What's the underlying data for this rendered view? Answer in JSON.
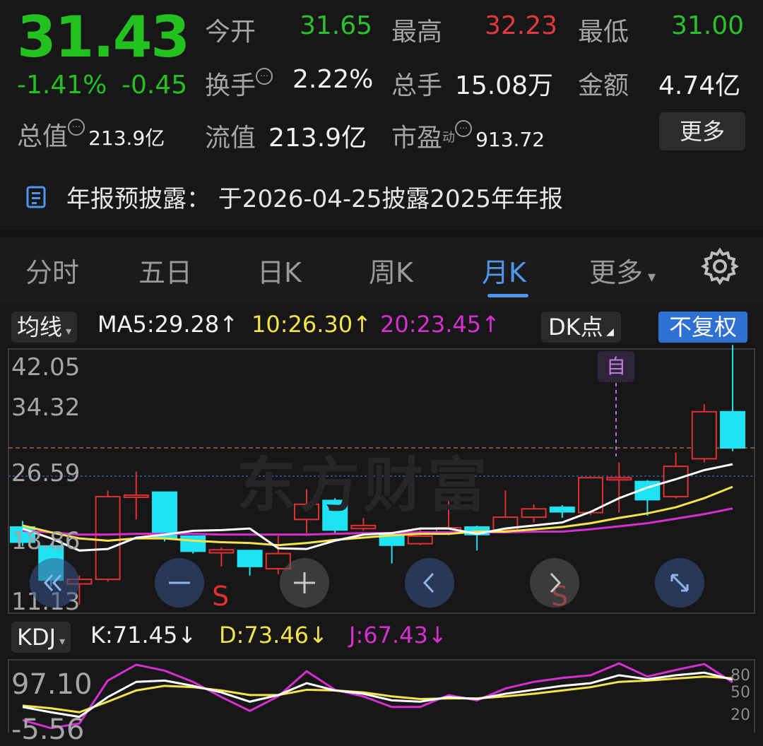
{
  "quote": {
    "price": "31.43",
    "change_pct": "-1.41%",
    "change": "-0.45",
    "open_label": "今开",
    "open": "31.65",
    "high_label": "最高",
    "high": "32.23",
    "low_label": "最低",
    "low": "31.00",
    "turnover_label": "换手",
    "turnover": "2.22%",
    "volume_label": "总手",
    "volume": "15.08万",
    "amount_label": "金额",
    "amount": "4.74亿",
    "mktcap_label": "总值",
    "mktcap": "213.9亿",
    "float_label": "流值",
    "float_cap": "213.9亿",
    "pe_label": "市盈",
    "pe_sup": "动",
    "pe": "913.72",
    "more_label": "更多"
  },
  "notice": {
    "text": "年报预披露：  于2026-04-25披露2025年年报"
  },
  "tabs": {
    "items": [
      "分时",
      "五日",
      "日K",
      "周K",
      "月K",
      "更多"
    ],
    "active": "月K"
  },
  "ma": {
    "type_label": "均线",
    "ma5": "MA5:29.28↑",
    "ma10": "10:26.30↑",
    "ma20": "20:23.45↑",
    "dk_label": "DK点",
    "adjust_label": "不复权",
    "colors": {
      "ma5": "#ffffff",
      "ma10": "#f5e34a",
      "ma20": "#d62fd0"
    }
  },
  "chart_data": {
    "type": "candlestick",
    "y_ticks": [
      "42.05",
      "34.32",
      "26.59",
      "18.86",
      "11.13"
    ],
    "ylim": [
      11.13,
      42.05
    ],
    "watermark": "东方财富",
    "self_marker": "自",
    "sell_marker": "S",
    "candles": [
      {
        "o": 21.0,
        "c": 19.0,
        "h": 21.8,
        "l": 18.5
      },
      {
        "o": 18.5,
        "c": 14.0,
        "h": 18.8,
        "l": 13.2
      },
      {
        "o": 13.5,
        "c": 14.1,
        "h": 14.6,
        "l": 10.8
      },
      {
        "o": 14.1,
        "c": 25.0,
        "h": 25.8,
        "l": 13.8
      },
      {
        "o": 25.2,
        "c": 25.2,
        "h": 28.3,
        "l": 22.0
      },
      {
        "o": 25.6,
        "c": 19.6,
        "h": 25.6,
        "l": 19.1
      },
      {
        "o": 19.8,
        "c": 17.8,
        "h": 19.9,
        "l": 17.5
      },
      {
        "o": 17.6,
        "c": 18.0,
        "h": 18.3,
        "l": 15.8
      },
      {
        "o": 17.9,
        "c": 15.8,
        "h": 17.9,
        "l": 14.6
      },
      {
        "o": 15.5,
        "c": 17.5,
        "h": 19.8,
        "l": 14.8
      },
      {
        "o": 22.0,
        "c": 24.0,
        "h": 26.0,
        "l": 20.2
      },
      {
        "o": 24.5,
        "c": 20.6,
        "h": 24.8,
        "l": 20.2
      },
      {
        "o": 20.8,
        "c": 21.2,
        "h": 22.2,
        "l": 20.5
      },
      {
        "o": 20.2,
        "c": 18.6,
        "h": 20.3,
        "l": 16.2
      },
      {
        "o": 18.8,
        "c": 19.8,
        "h": 20.9,
        "l": 18.6
      },
      {
        "o": 20.3,
        "c": 20.9,
        "h": 25.0,
        "l": 19.9
      },
      {
        "o": 21.0,
        "c": 20.0,
        "h": 21.2,
        "l": 17.9
      },
      {
        "o": 20.6,
        "c": 22.3,
        "h": 25.8,
        "l": 20.2
      },
      {
        "o": 22.3,
        "c": 23.4,
        "h": 24.0,
        "l": 21.6
      },
      {
        "o": 23.6,
        "c": 23.0,
        "h": 23.9,
        "l": 22.2
      },
      {
        "o": 22.9,
        "c": 27.5,
        "h": 27.6,
        "l": 22.6
      },
      {
        "o": 27.5,
        "c": 27.5,
        "h": 29.5,
        "l": 22.9
      },
      {
        "o": 27.0,
        "c": 24.6,
        "h": 27.2,
        "l": 22.5
      },
      {
        "o": 25.0,
        "c": 29.0,
        "h": 30.8,
        "l": 24.8
      },
      {
        "o": 30.0,
        "c": 36.2,
        "h": 37.2,
        "l": 29.5
      },
      {
        "o": 36.2,
        "c": 31.43,
        "h": 45.0,
        "l": 31.0
      }
    ],
    "ma5": [
      20.8,
      19.5,
      17.9,
      18.1,
      19.6,
      20.0,
      20.5,
      20.6,
      20.8,
      18.2,
      18.1,
      19.2,
      20.0,
      20.2,
      20.8,
      20.8,
      20.1,
      20.8,
      21.2,
      21.6,
      23.0,
      24.8,
      26.2,
      27.3,
      28.5,
      29.28
    ],
    "ma10": [
      21.2,
      20.3,
      19.5,
      19.2,
      19.5,
      19.5,
      19.2,
      19.0,
      18.9,
      18.6,
      18.9,
      19.3,
      19.6,
      19.9,
      20.1,
      20.1,
      20.4,
      20.4,
      20.7,
      21.0,
      21.5,
      22.2,
      22.8,
      23.6,
      24.8,
      26.3
    ],
    "ma20": [
      20.5,
      20.3,
      20.0,
      20.0,
      20.1,
      20.1,
      20.1,
      20.0,
      20.0,
      20.0,
      20.0,
      20.1,
      20.2,
      20.2,
      20.3,
      20.3,
      20.3,
      20.3,
      20.4,
      20.4,
      20.7,
      21.1,
      21.5,
      22.1,
      22.7,
      23.45
    ],
    "dashed_price": 31.43
  },
  "kdj": {
    "label": "KDJ",
    "k": "K:71.45↓",
    "d": "D:73.46↓",
    "j": "J:67.43↓",
    "axis_left": [
      "97.10",
      "-5.56"
    ],
    "axis_right": [
      "80",
      "50",
      "20"
    ],
    "k_values": [
      30,
      22,
      15,
      45,
      68,
      70,
      62,
      52,
      38,
      48,
      66,
      55,
      50,
      40,
      38,
      45,
      42,
      50,
      56,
      62,
      66,
      78,
      72,
      78,
      82,
      71.45
    ],
    "d_values": [
      32,
      28,
      22,
      38,
      55,
      62,
      60,
      55,
      48,
      48,
      56,
      55,
      52,
      46,
      42,
      43,
      43,
      46,
      50,
      55,
      60,
      68,
      70,
      73,
      76,
      73.46
    ],
    "j_values": [
      10,
      -2,
      5,
      70,
      94,
      85,
      68,
      45,
      24,
      46,
      84,
      56,
      46,
      30,
      30,
      48,
      40,
      58,
      68,
      74,
      78,
      96,
      76,
      86,
      95,
      67.43
    ]
  },
  "overlay": {
    "buttons": [
      "double-left",
      "zoom-out",
      "zoom-in",
      "prev",
      "next",
      "fullscreen"
    ]
  }
}
